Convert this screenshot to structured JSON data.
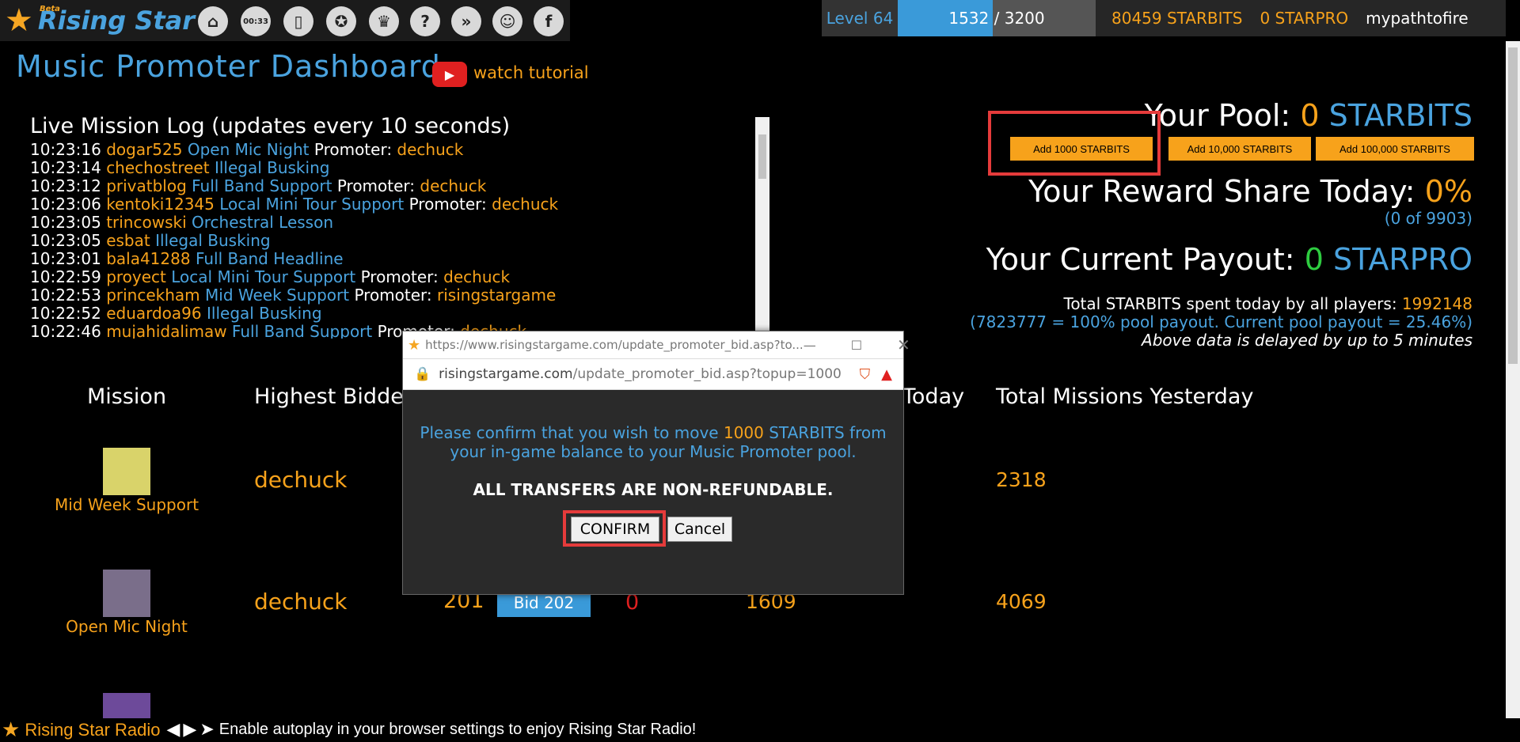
{
  "brand": {
    "name": "Rising Star",
    "beta": "Beta"
  },
  "nav_icons": [
    "home-icon",
    "clock-icon",
    "cards-icon",
    "award-icon",
    "trophy-icon",
    "help-icon",
    "hive-icon",
    "discord-icon",
    "facebook-icon"
  ],
  "nav_clock_text": "00:33",
  "stats": {
    "level_label": "Level 64",
    "xp_current": "1532",
    "xp_sep": " / ",
    "xp_max": "3200",
    "xp_fraction": 0.479,
    "starbits": "80459 STARBITS",
    "starpro": "0 STARPRO",
    "username": "mypathtofire"
  },
  "page": {
    "title": "Music Promoter Dashboard",
    "watch_label": "watch tutorial"
  },
  "log": {
    "title": "Live Mission Log (updates every 10 seconds)",
    "promoter_label": "Promoter:",
    "rows": [
      {
        "time": "10:23:16",
        "user": "dogar525",
        "mission": "Open Mic Night",
        "promoter": "dechuck"
      },
      {
        "time": "10:23:14",
        "user": "chechostreet",
        "mission": "Illegal Busking",
        "promoter": ""
      },
      {
        "time": "10:23:12",
        "user": "privatblog",
        "mission": "Full Band Support",
        "promoter": "dechuck"
      },
      {
        "time": "10:23:06",
        "user": "kentoki12345",
        "mission": "Local Mini Tour Support",
        "promoter": "dechuck"
      },
      {
        "time": "10:23:05",
        "user": "trincowski",
        "mission": "Orchestral Lesson",
        "promoter": ""
      },
      {
        "time": "10:23:05",
        "user": "esbat",
        "mission": "Illegal Busking",
        "promoter": ""
      },
      {
        "time": "10:23:01",
        "user": "bala41288",
        "mission": "Full Band Headline",
        "promoter": ""
      },
      {
        "time": "10:22:59",
        "user": "proyect",
        "mission": "Local Mini Tour Support",
        "promoter": "dechuck"
      },
      {
        "time": "10:22:53",
        "user": "princekham",
        "mission": "Mid Week Support",
        "promoter": "risingstargame"
      },
      {
        "time": "10:22:52",
        "user": "eduardoa96",
        "mission": "Illegal Busking",
        "promoter": ""
      },
      {
        "time": "10:22:46",
        "user": "mujahidalimaw",
        "mission": "Full Band Support",
        "promoter": "dechuck"
      }
    ]
  },
  "pool": {
    "label": "Your Pool:",
    "amount": "0",
    "unit": "STARBITS",
    "btn_1000": "Add 1000 STARBITS",
    "btn_10000": "Add 10,000 STARBITS",
    "btn_100000": "Add 100,000 STARBITS"
  },
  "reward": {
    "label": "Your Reward Share Today:",
    "value": "0%",
    "sub": "(0 of 9903)"
  },
  "payout": {
    "label": "Your Current Payout:",
    "value": "0",
    "unit": "STARPRO"
  },
  "totals": {
    "spent_label": "Total STARBITS spent today by all players:",
    "spent_value": "1992148",
    "pool_payout_line": "(7823777 = 100% pool payout. Current pool payout = 25.46%)",
    "delay_note": "Above data is delayed by up to 5 minutes"
  },
  "table": {
    "headers": {
      "mission": "Mission",
      "highest_bidder": "Highest Bidde",
      "today": "Today",
      "yesterday": "Total Missions Yesterday"
    },
    "rows": [
      {
        "mission": "Mid Week Support",
        "bidder": "dechuck",
        "yesterday": "2318"
      },
      {
        "mission": "Open Mic Night",
        "bidder": "dechuck",
        "bid_amount": "201",
        "bid_btn": "Bid 202",
        "mine": "0",
        "today": "1609",
        "yesterday": "4069"
      }
    ]
  },
  "modal": {
    "window_title": "https://www.risingstargame.com/update_promoter_bid.asp?to...",
    "url_domain": "risingstargame.com",
    "url_path": "/update_promoter_bid.asp?topup=1000",
    "msg_pre": "Please confirm that you wish to move",
    "msg_amount": "1000",
    "msg_post": "STARBITS from your in-game balance to your Music Promoter pool.",
    "warning": "ALL TRANSFERS ARE NON-REFUNDABLE.",
    "confirm_label": "CONFIRM",
    "cancel_label": "Cancel"
  },
  "radio": {
    "title": "Rising Star Radio",
    "message": "Enable autoplay in your browser settings to enjoy Rising Star Radio!"
  }
}
